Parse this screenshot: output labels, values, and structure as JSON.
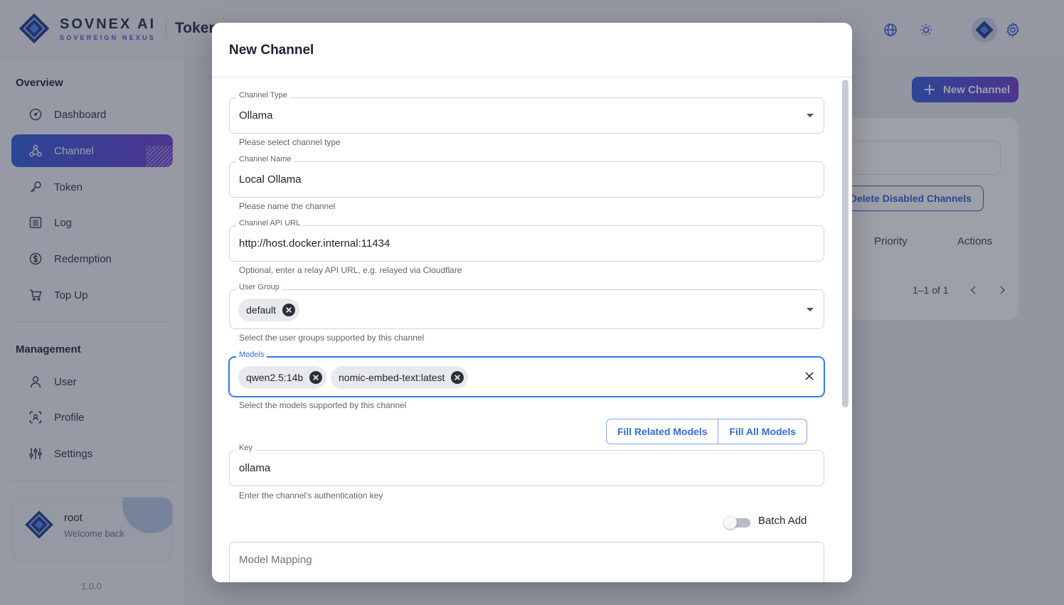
{
  "brand": {
    "name": "SOVNEX AI",
    "tagline": "SOVEREIGN NEXUS"
  },
  "page_title": "Token",
  "sidebar": {
    "overview_heading": "Overview",
    "overview_items": [
      {
        "label": "Dashboard",
        "icon": "dashboard-icon"
      },
      {
        "label": "Channel",
        "icon": "channel-icon",
        "active": true
      },
      {
        "label": "Token",
        "icon": "key-icon"
      },
      {
        "label": "Log",
        "icon": "log-icon"
      },
      {
        "label": "Redemption",
        "icon": "dollar-icon"
      },
      {
        "label": "Top Up",
        "icon": "cart-icon"
      }
    ],
    "management_heading": "Management",
    "management_items": [
      {
        "label": "User",
        "icon": "user-icon"
      },
      {
        "label": "Profile",
        "icon": "profile-icon"
      },
      {
        "label": "Settings",
        "icon": "settings-icon"
      }
    ],
    "user": {
      "name": "root",
      "greeting": "Welcome back"
    },
    "version": "1.0.0"
  },
  "background": {
    "new_channel_label": "New Channel",
    "delete_disabled_label": "Delete Disabled Channels",
    "columns": [
      "Priority",
      "Actions"
    ],
    "pagination": "1–1 of 1"
  },
  "dialog": {
    "title": "New Channel",
    "channel_type": {
      "label": "Channel Type",
      "value": "Ollama",
      "helper": "Please select channel type"
    },
    "channel_name": {
      "label": "Channel Name",
      "value": "Local Ollama",
      "helper": "Please name the channel"
    },
    "api_url": {
      "label": "Channel API URL",
      "value": "http://host.docker.internal:11434",
      "helper": "Optional, enter a relay API URL, e.g. relayed via Cloudflare"
    },
    "user_group": {
      "label": "User Group",
      "chips": [
        "default"
      ],
      "helper": "Select the user groups supported by this channel"
    },
    "models": {
      "label": "Models",
      "chips": [
        "qwen2.5:14b",
        "nomic-embed-text:latest"
      ],
      "helper": "Select the models supported by this channel"
    },
    "fill_related_label": "Fill Related Models",
    "fill_all_label": "Fill All Models",
    "key": {
      "label": "Key",
      "value": "ollama",
      "helper": "Enter the channel's authentication key"
    },
    "batch_add_label": "Batch Add",
    "batch_add_on": false,
    "model_mapping_placeholder": "Model Mapping"
  },
  "colors": {
    "accent": "#2f5be0",
    "accent_end": "#6a3bd6",
    "focus": "#2f7bea"
  }
}
